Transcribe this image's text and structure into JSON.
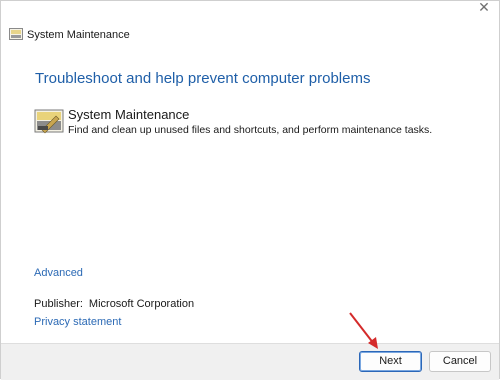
{
  "window": {
    "title": "System Maintenance",
    "close_glyph": "✕"
  },
  "main": {
    "heading": "Troubleshoot and help prevent computer problems",
    "task": {
      "icon": "system-maintenance-icon",
      "title": "System Maintenance",
      "description": "Find and clean up unused files and shortcuts, and perform maintenance tasks."
    },
    "advanced_link": "Advanced",
    "publisher_label": "Publisher:",
    "publisher_value": "Microsoft Corporation",
    "privacy_link": "Privacy statement"
  },
  "footer": {
    "next_label": "Next",
    "cancel_label": "Cancel"
  },
  "colors": {
    "heading": "#1f5fa8",
    "link": "#2c6ab5",
    "footer_bg": "#f0f0f0",
    "annotation_arrow": "#d42a2a"
  }
}
